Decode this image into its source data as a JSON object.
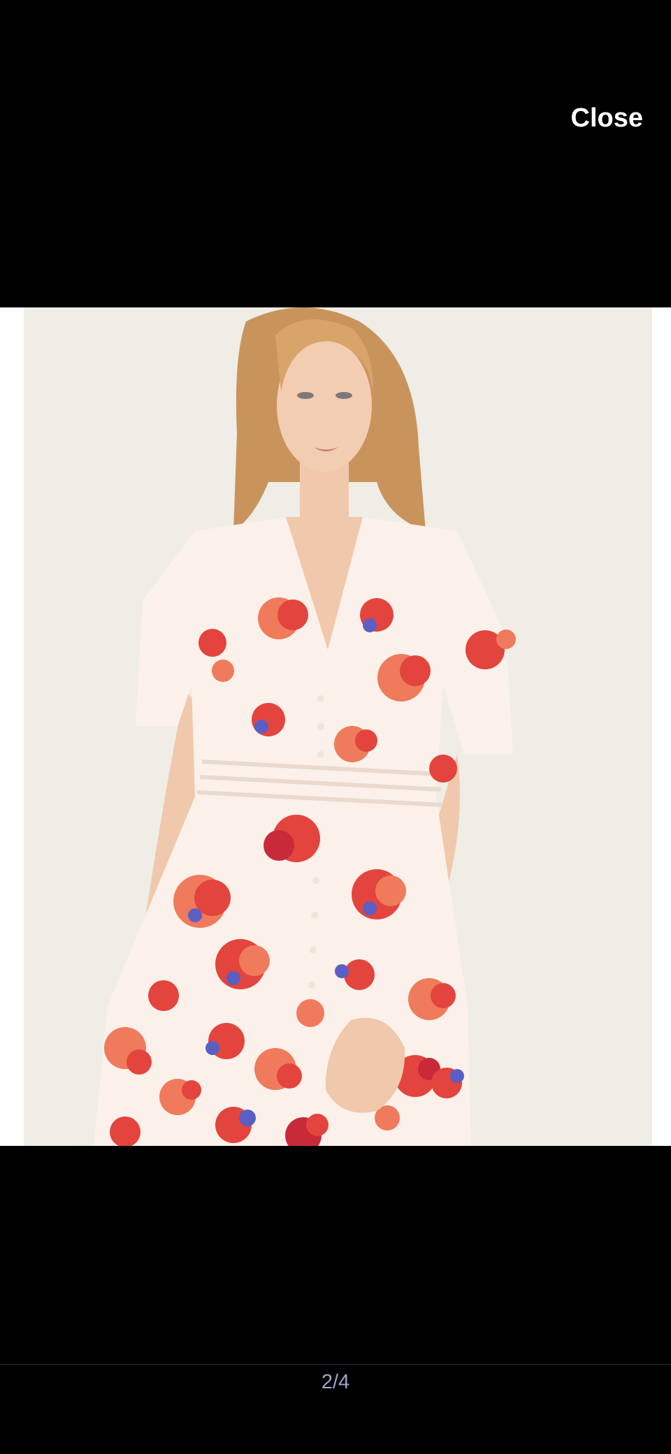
{
  "viewer": {
    "close_label": "Close",
    "page_counter": "2/4"
  },
  "image": {
    "subject": "model-in-floral-dress",
    "background_color": "#efede6",
    "dress_color": "#fbf1ea",
    "flower_colors": [
      "#e3443d",
      "#f07a5c",
      "#5a5fc4",
      "#c92a3a"
    ]
  },
  "icons": []
}
